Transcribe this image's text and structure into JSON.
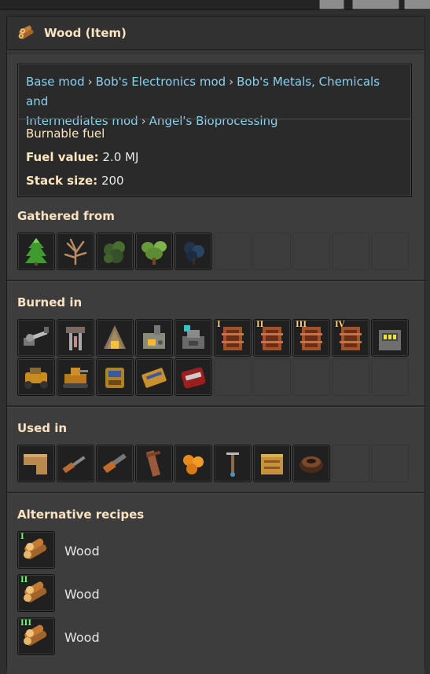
{
  "window": {
    "title": "Wood (Item)"
  },
  "info": {
    "mods": [
      "Base mod",
      "Bob's Electronics mod",
      "Bob's Metals, Chemicals and",
      "Intermediates mod",
      "Angel's Bioprocessing"
    ],
    "burnable": "Burnable fuel",
    "fuel_label": "Fuel value:",
    "fuel_value": "2.0 MJ",
    "stack_label": "Stack size:",
    "stack_value": "200"
  },
  "sections": {
    "gathered": "Gathered from",
    "burned": "Burned in",
    "used": "Used in",
    "alternative": "Alternative recipes"
  },
  "tiers": [
    "I",
    "II",
    "III",
    "IV"
  ],
  "alternative_recipes": [
    {
      "tier": "I",
      "label": "Wood"
    },
    {
      "tier": "II",
      "label": "Wood"
    },
    {
      "tier": "III",
      "label": "Wood"
    }
  ],
  "colors": {
    "heading": "#fbe3c1",
    "link": "#8ad1ef",
    "panel": "#3d3d3d"
  }
}
